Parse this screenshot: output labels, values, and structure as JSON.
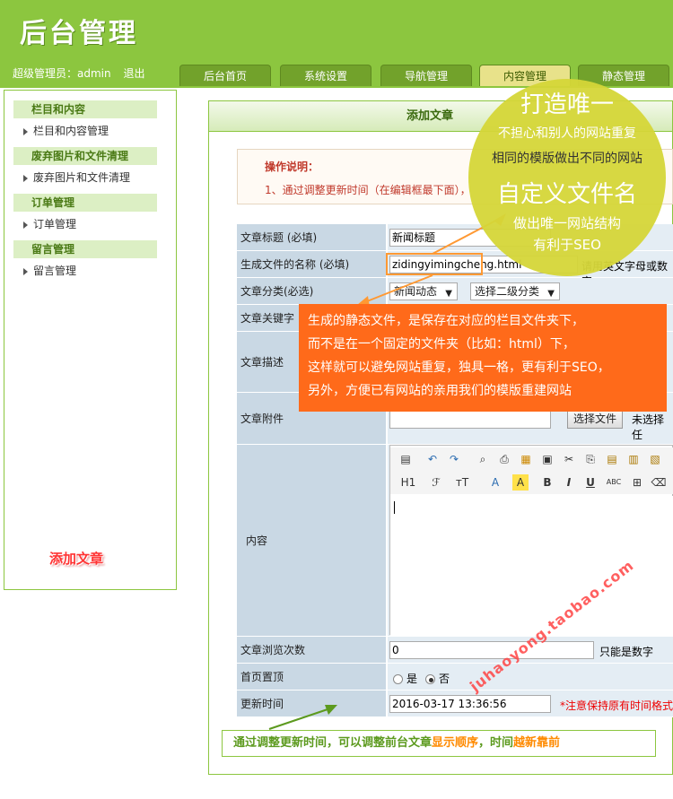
{
  "header": {
    "logo_text": "后台管理",
    "admin_label": "超级管理员：admin",
    "logout_label": "退出"
  },
  "tabs": [
    "后台首页",
    "系统设置",
    "导航管理",
    "内容管理",
    "静态管理"
  ],
  "sidebar": {
    "groups": [
      {
        "title": "栏目和内容",
        "item": "栏目和内容管理"
      },
      {
        "title": "废弃图片和文件清理",
        "item": "废弃图片和文件清理"
      },
      {
        "title": "订单管理",
        "item": "订单管理"
      },
      {
        "title": "留言管理",
        "item": "留言管理"
      }
    ],
    "tag": "添加文章"
  },
  "main": {
    "title": "添加文章",
    "notice_title": "操作说明：",
    "notice_line": "1、通过调整更新时间（在编辑框最下面），"
  },
  "form": {
    "title_label": "文章标题 (必填)",
    "title_value": "新闻标题",
    "filename_label": "生成文件的名称 (必填)",
    "filename_value": "zidingyimingcheng",
    "filename_ext": ".html",
    "filename_hint": "请用英文字母或数字",
    "category_label": "文章分类(必选)",
    "category_value": "新闻动态",
    "category_sub": "选择二级分类",
    "keywords_label": "文章关键字",
    "desc_label": "文章描述",
    "attach_label": "文章附件",
    "attach_button": "选择文件",
    "attach_status": "未选择任",
    "content_label": "内容",
    "views_label": "文章浏览次数",
    "views_value": "0",
    "views_hint": "只能是数字",
    "top_label": "首页置顶",
    "top_yes": "是",
    "top_no": "否",
    "time_label": "更新时间",
    "time_value": "2016-03-17 13:36:56",
    "time_hint": "*注意保持原有时间格式"
  },
  "editor": {
    "heading_btn": "H1",
    "font_btn": "ℱ",
    "size_btn": "тT",
    "color_btn": "A",
    "bg_btn": "A",
    "bold_btn": "B",
    "italic_btn": "I",
    "underline_btn": "U",
    "strike_btn": "ABC"
  },
  "overlay": {
    "circle_line1": "打造唯一",
    "circle_line2": "不担心和别人的网站重复",
    "circle_line3": "相同的模版做出不同的网站",
    "circle_line4": "自定义文件名",
    "circle_line5": "做出唯一网站结构",
    "circle_line6": "有利于SEO",
    "orange_line1": "生成的静态文件，是保存在对应的栏目文件夹下，",
    "orange_line2": "而不是在一个固定的文件夹（比如：html）下，",
    "orange_line3": "这样就可以避免网站重复，独具一格，更有利于SEO，",
    "orange_line4": "另外，方便已有网站的亲用我们的模版重建网站",
    "green_part1": "通过调整更新时间，可以调整前台文章",
    "green_part2": "显示顺序",
    "green_part3": "，时间",
    "green_part4": "越新靠前",
    "watermark": "juhaoyong.taobao.com"
  }
}
